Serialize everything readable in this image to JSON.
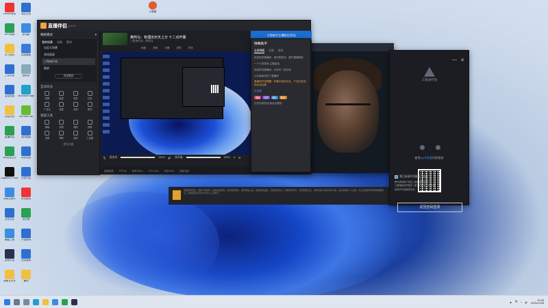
{
  "desktop": {
    "icons": [
      {
        "label": "Lenovo快传",
        "color": "#e33"
      },
      {
        "label": "测试文档",
        "color": "#2f6fd0"
      },
      {
        "label": "WPS表格",
        "color": "#2aa052"
      },
      {
        "label": "此电脑",
        "color": "#3b8de0"
      },
      {
        "label": "学习资料",
        "color": "#f0c040"
      },
      {
        "label": "控制面板",
        "color": "#3c7ad8"
      },
      {
        "label": "工作记录",
        "color": "#2f6fd0"
      },
      {
        "label": "回收站",
        "color": "#8ab"
      },
      {
        "label": "会议纪要",
        "color": "#2f6fd0"
      },
      {
        "label": "Microsoft Edge",
        "color": "#21a0c8"
      },
      {
        "label": "项目计划",
        "color": "#f0c040"
      },
      {
        "label": "GeForce Exp",
        "color": "#6b3"
      },
      {
        "label": "直播伴侣",
        "color": "#2aa052"
      },
      {
        "label": "简历模板",
        "color": "#2f6fd0"
      },
      {
        "label": "360安全卫士",
        "color": "#2aa052"
      },
      {
        "label": "年终总结",
        "color": "#2f6fd0"
      },
      {
        "label": "Logitech G HUB",
        "color": "#111"
      },
      {
        "label": "公司介绍",
        "color": "#2f6fd0"
      },
      {
        "label": "网易云音乐",
        "color": "#3b8de0"
      },
      {
        "label": "财务报表",
        "color": "#e33"
      },
      {
        "label": "共享文件",
        "color": "#2f6fd0"
      },
      {
        "label": "设计稿",
        "color": "#2aa052"
      },
      {
        "label": "截图工具",
        "color": "#3b8de0"
      },
      {
        "label": "产品说明",
        "color": "#2f6fd0"
      },
      {
        "label": "游戏平台",
        "color": "#2a3050"
      },
      {
        "label": "任务清单",
        "color": "#2f6fd0"
      },
      {
        "label": "新建文件夹",
        "color": "#f0c040"
      },
      {
        "label": "备份",
        "color": "#f0c040"
      }
    ],
    "top_app": "小狐狸"
  },
  "stream_app": {
    "brand": "直播伴侣",
    "version": "6.4.2.4",
    "mode_label": "横屏模式",
    "scene_section": "我的场景",
    "scene_tabs": [
      "场景",
      "素材"
    ],
    "scenes": [
      "自定义场景",
      "游戏画面",
      "三角洲行动",
      "截屏"
    ],
    "add_scene": "添加素材",
    "interact_section": "互动玩法",
    "interact_tools": [
      "投票",
      "抽奖",
      "竞猜",
      "红包",
      "广告位",
      "连麦",
      "全部",
      "更多"
    ],
    "basic_section": "基础工具",
    "basic_tools": [
      "弹幕",
      "录制",
      "美颜",
      "剪辑",
      "设置",
      "帮助",
      "音效",
      "工具箱"
    ],
    "more_label": "更多功能",
    "room_name": "黄阿马：有理出天天上分 十二点开播",
    "room_sub": "三角洲行动 · 房间号",
    "room_stats": [
      "专属频道",
      "主播赛道",
      "关注我的",
      "290人"
    ],
    "preview_tabs": [
      "画面",
      "音频",
      "设备",
      "滤镜",
      "特效"
    ],
    "mic_label": "麦克风",
    "mic_pct": "100%",
    "speaker_label": "扬声器",
    "speaker_pct": "100%",
    "ctrl_icons": [
      "麦克风",
      "录制",
      "设置"
    ],
    "live_button": "开始直播...",
    "status_items": [
      "直播线路",
      "FPS:60",
      "码率:0kb/s",
      "CPU:12%",
      "内存:54%",
      "网络:良好"
    ],
    "banner": "斗鱼助力主播抢位活动"
  },
  "chat_panel": {
    "title": "弹幕助手",
    "tabs": [
      "全部弹幕",
      "礼物",
      "进房"
    ],
    "messages": [
      "欢迎来到直播间，请文明发言，遵守直播规范",
      "一个人的游戏 主播加油",
      "欢迎来到直播间，水友们一起互动",
      "小红偷偷走进了直播间",
      "直播间开奖提醒：恭喜中奖的水友，产品已发送到水友包裹"
    ],
    "action_label": "去查看",
    "badges": [
      "老婆",
      "守护",
      "骑士",
      "粉丝"
    ],
    "footer_line": "记住你说的话 我会去看的"
  },
  "login_dialog": {
    "game_title": "三角洲行动",
    "hint_prefix": "使用",
    "hint_link": "QQ手机版",
    "hint_suffix": "扫码登录",
    "password_button": "返回密码登录",
    "agree_text": "我已阅读并同意用户协议",
    "links": [
      "腾讯游戏用户协议 | 隐私保护指引",
      "儿童隐私保护指引 | 第三方信息共享清单",
      "游戏许可及服务协议"
    ],
    "close_icon": "close-icon",
    "minimize_icon": "minimize-icon"
  },
  "launcher": {
    "footer_text": "健康游戏忠告：抵制不良游戏，拒绝盗版游戏。注意自我保护，谨防受骗上当。适度游戏益脑，沉迷游戏伤身。合理安排时间，享受健康生活。 游戏内容以游戏实际为准，请注意保护个人信息，防止泄露账号密码等重要信息。本游戏适合年满16周岁以上的用户。"
  },
  "taskbar": {
    "time": "20:35",
    "date": "2025/12/28",
    "tray": [
      "中",
      "▲"
    ]
  },
  "colors": {
    "accent_blue": "#4a8ff0",
    "stream_dark": "#1e1f24",
    "brand_orange": "#f2a33a"
  }
}
